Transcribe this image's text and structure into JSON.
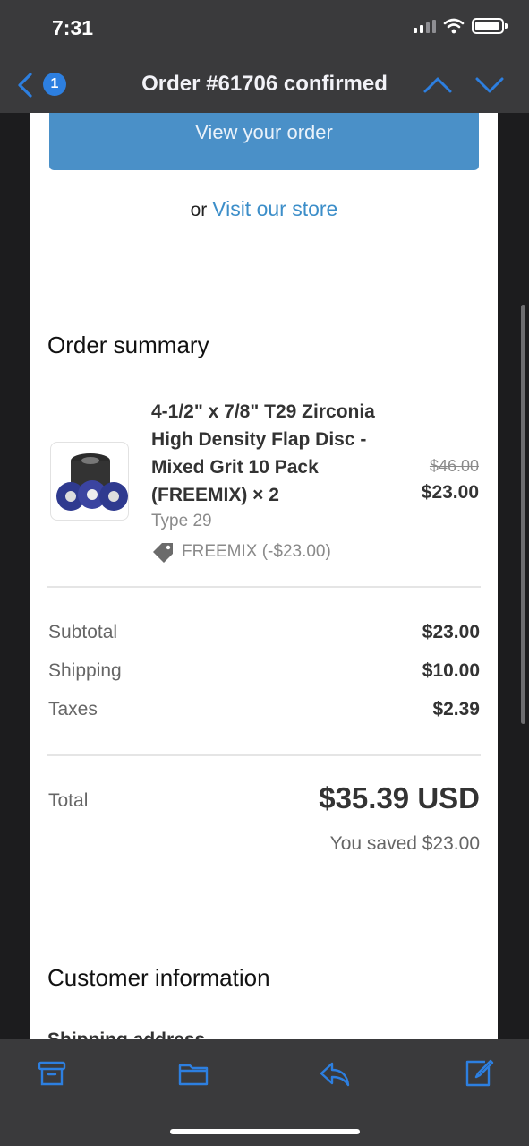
{
  "status": {
    "time": "7:31"
  },
  "nav": {
    "unread_count": "1",
    "title": "Order #61706 confirmed"
  },
  "email": {
    "view_order_label": "View your order",
    "or_text": "or",
    "visit_store_label": "Visit our store",
    "order_summary_title": "Order summary",
    "item": {
      "name": "4-1/2\" x 7/8\" T29 Zirconia High Density Flap Disc - Mixed Grit 10 Pack (FREEMIX) × 2",
      "variant": "Type 29",
      "discount": "FREEMIX (-$23.00)",
      "original_price": "$46.00",
      "price": "$23.00"
    },
    "totals": [
      {
        "label": "Subtotal",
        "value": "$23.00"
      },
      {
        "label": "Shipping",
        "value": "$10.00"
      },
      {
        "label": "Taxes",
        "value": "$2.39"
      }
    ],
    "total_label": "Total",
    "total_value": "$35.39 USD",
    "saved_text": "You saved $23.00",
    "customer_info_title": "Customer information",
    "shipping_address_label": "Shipping address"
  },
  "icons": [
    "back-chevron-icon",
    "chevron-up-icon",
    "chevron-down-icon",
    "archive-icon",
    "folder-icon",
    "reply-icon",
    "compose-icon"
  ],
  "colors": {
    "accent": "#2d7fe0",
    "button": "#4a90c8",
    "link": "#3c8ec9"
  }
}
